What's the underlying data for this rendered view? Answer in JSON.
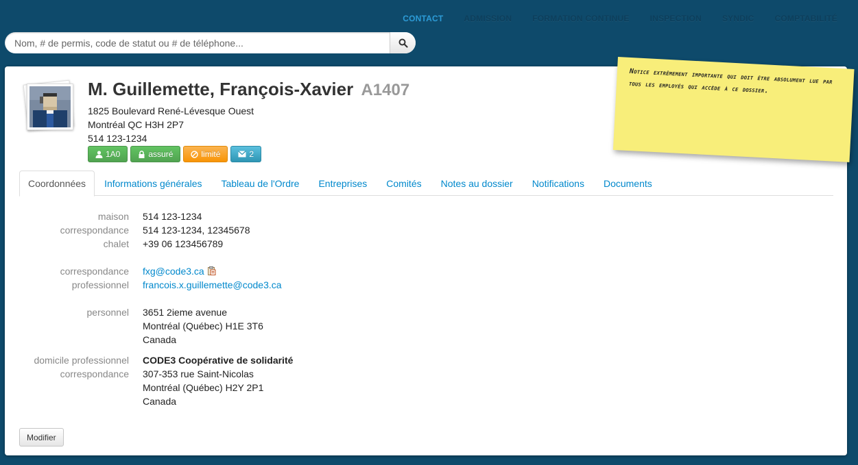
{
  "nav": {
    "items": [
      {
        "label": "CONTACT",
        "active": true
      },
      {
        "label": "ADMISSION",
        "active": false
      },
      {
        "label": "FORMATION CONTINUE",
        "active": false
      },
      {
        "label": "INSPECTION",
        "active": false
      },
      {
        "label": "SYNDIC",
        "active": false
      },
      {
        "label": "COMPTABILITÉ",
        "active": false
      }
    ]
  },
  "search": {
    "placeholder": "Nom, # de permis, code de statut ou # de téléphone...",
    "value": "",
    "button_icon": "search-icon"
  },
  "profile": {
    "name": "M. Guillemette, François-Xavier",
    "permit": "A1407",
    "address_line1": "1825 Boulevard René-Lévesque Ouest",
    "address_line2": "Montréal QC  H3H 2P7",
    "phone": "514 123-1234",
    "badges": [
      {
        "label": "1A0",
        "icon": "user-icon",
        "color": "#5bb75b"
      },
      {
        "label": "assuré",
        "icon": "lock-icon",
        "color": "#5bb75b"
      },
      {
        "label": "limité",
        "icon": "ban-icon",
        "color": "#faa732"
      },
      {
        "label": "2",
        "icon": "envelope-icon",
        "color": "#49afcd"
      }
    ]
  },
  "tabs": [
    {
      "label": "Coordonnées",
      "active": true
    },
    {
      "label": "Informations générales",
      "active": false
    },
    {
      "label": "Tableau de l'Ordre",
      "active": false
    },
    {
      "label": "Entreprises",
      "active": false
    },
    {
      "label": "Comités",
      "active": false
    },
    {
      "label": "Notes au dossier",
      "active": false
    },
    {
      "label": "Notifications",
      "active": false
    },
    {
      "label": "Documents",
      "active": false
    }
  ],
  "phones": [
    {
      "label": "maison",
      "value": "514 123-1234"
    },
    {
      "label": "correspondance",
      "value": "514 123-1234, 12345678"
    },
    {
      "label": "chalet",
      "value": "+39 06 123456789"
    }
  ],
  "emails": [
    {
      "label": "correspondance",
      "value": "fxg@code3.ca",
      "copy_icon": "copy-icon"
    },
    {
      "label": "professionnel",
      "value": "francois.x.guillemette@code3.ca"
    }
  ],
  "address_personal": {
    "label": "personnel",
    "line1": "3651 2ieme avenue",
    "line2": "Montréal (Québec) H1E 3T6",
    "line3": "Canada"
  },
  "address_work": {
    "label1": "domicile professionnel",
    "label2": "correspondance",
    "company": "CODE3 Coopérative de solidarité",
    "line1": "307-353 rue Saint-Nicolas",
    "line2": "Montréal (Québec) H2Y 2P1",
    "line3": "Canada"
  },
  "actions": {
    "modify_label": "Modifier"
  },
  "sticky_note": {
    "text": "Notice extrêmement importante qui doit être absolument lue par tous les employés qui accède à ce dossier."
  },
  "colors": {
    "background": "#0e4a6b",
    "link": "#0088cc",
    "nav_active": "#2a9ad6",
    "note": "#f8ee7a"
  }
}
